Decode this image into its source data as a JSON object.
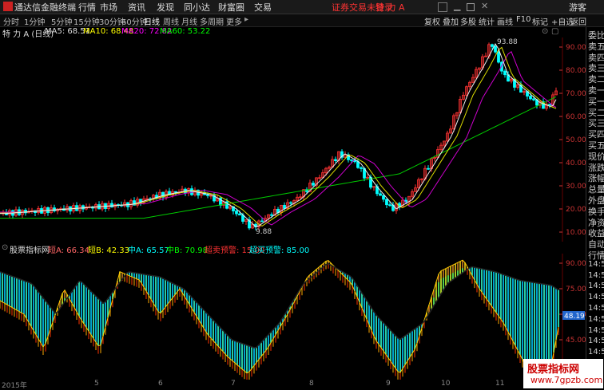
{
  "titlebar": {
    "app_name": "通达信金融终端",
    "menu": [
      "行情",
      "市场",
      "资讯",
      "发现",
      "同小达",
      "财富圈",
      "交易"
    ],
    "notice": "证券交易未登录",
    "stock": "特 力 A",
    "user": "游客"
  },
  "toolbar": {
    "periods": [
      "分时",
      "1分钟",
      "5分钟",
      "15分钟",
      "30分钟",
      "60分钟",
      "日线",
      "周线",
      "月线",
      "多周期",
      "更多"
    ],
    "right_buttons": [
      "复权",
      "叠加",
      "多股",
      "统计",
      "画线",
      "F10",
      "标记",
      "+自选",
      "返回"
    ]
  },
  "info": {
    "title": "特 力 A (日线)",
    "ma5_label": "MA5: 68.51",
    "ma10_label": "MA10: 68.48",
    "ma20_label": "MA20: 72.82",
    "ma60_label": "MA60: 53.22"
  },
  "price_axis": [
    "90.00",
    "80.00",
    "70.00",
    "60.00",
    "50.00",
    "40.00",
    "30.00",
    "20.00",
    "10.00"
  ],
  "annotations": {
    "high": "93.88",
    "low": "9.88"
  },
  "indicator": {
    "name": "股票指标网",
    "a": "短A: 66.34",
    "b": "短B: 42.33",
    "c": "中A: 65.57",
    "d": "中B: 70.98",
    "warn": "超卖预警: 15.00",
    "warn2": "超买预警: 85.00",
    "axis": [
      "90.00",
      "75.00",
      "60.00",
      "45.00",
      "30.00"
    ],
    "current": "48.19"
  },
  "right_panel": [
    "委比",
    "卖五",
    "卖四",
    "卖三",
    "卖二",
    "卖一",
    "买一",
    "买二",
    "买三",
    "买四",
    "买五",
    "现价",
    "涨跌",
    "涨幅",
    "总量",
    "外盘",
    "换手",
    "净资",
    "收益",
    "自动",
    "行情",
    "14:50",
    "14:50",
    "14:50",
    "14:50",
    "14:50",
    "14:50",
    "14:50",
    "14:50",
    "14:50"
  ],
  "date_axis": [
    "2015年",
    "5",
    "6",
    "7",
    "8",
    "9",
    "10",
    "11",
    "12"
  ],
  "watermark": {
    "line1": "股票指标网",
    "line2": "www.7gpzb.com"
  },
  "colors": {
    "ma5": "#ffffff",
    "ma10": "#ffff00",
    "ma20": "#ff00ff",
    "ma60": "#00ff00",
    "up": "#ff3333",
    "down": "#00ffff"
  }
}
